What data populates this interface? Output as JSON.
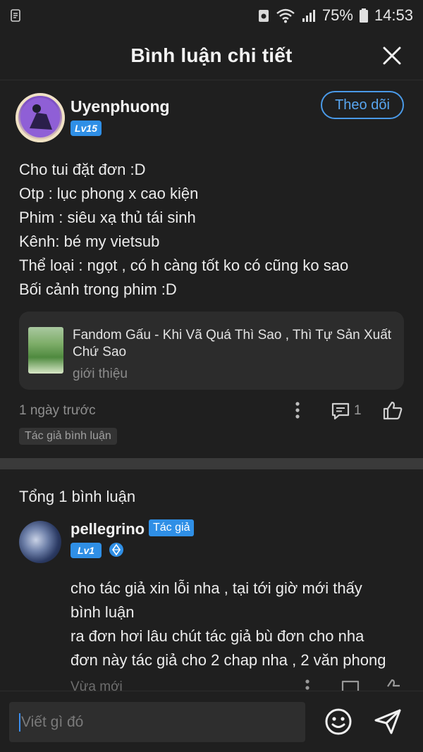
{
  "status_bar": {
    "battery": "75%",
    "time": "14:53"
  },
  "header": {
    "title": "Bình luận chi tiết"
  },
  "post": {
    "author": "Uyenphuong",
    "level": "Lv15",
    "follow_label": "Theo dõi",
    "lines": [
      "Cho tui đặt đơn :D",
      "Otp : lục phong x cao kiện",
      "Phim : siêu xạ thủ tái sinh",
      "Kênh: bé my vietsub",
      "Thể loại : ngọt , có h càng tốt ko có cũng ko sao",
      "Bối cảnh trong phim :D"
    ],
    "book": {
      "title": "Fandom Gấu - Khi Vã Quá Thì Sao , Thì Tự Sản Xuất Chứ Sao",
      "subtitle": "giới thiệu"
    },
    "time": "1 ngày trước",
    "comment_count": "1",
    "tag": "Tác giả bình luận"
  },
  "comments": {
    "total_label": "Tổng 1 bình luận",
    "items": [
      {
        "author": "pellegrino",
        "role": "Tác giả",
        "level": "Lv1",
        "lines": [
          "cho tác giả xin lỗi nha , tại tới giờ mới thấy",
          "bình luận",
          "ra đơn hơi lâu chút tác giả bù đơn cho nha",
          "đơn này tác giả cho 2 chap nha , 2 văn phong"
        ],
        "time": "Vừa mới"
      }
    ]
  },
  "input": {
    "placeholder": "Viết gì đó"
  },
  "colors": {
    "accent": "#2f8fe6",
    "background": "#1f1f1f",
    "card": "#2c2c2c"
  },
  "icons": [
    "close-icon",
    "more-icon",
    "comment-icon",
    "like-icon",
    "emoji-icon",
    "send-icon",
    "verify-icon",
    "wifi-icon",
    "signal-icon",
    "battery-icon"
  ]
}
